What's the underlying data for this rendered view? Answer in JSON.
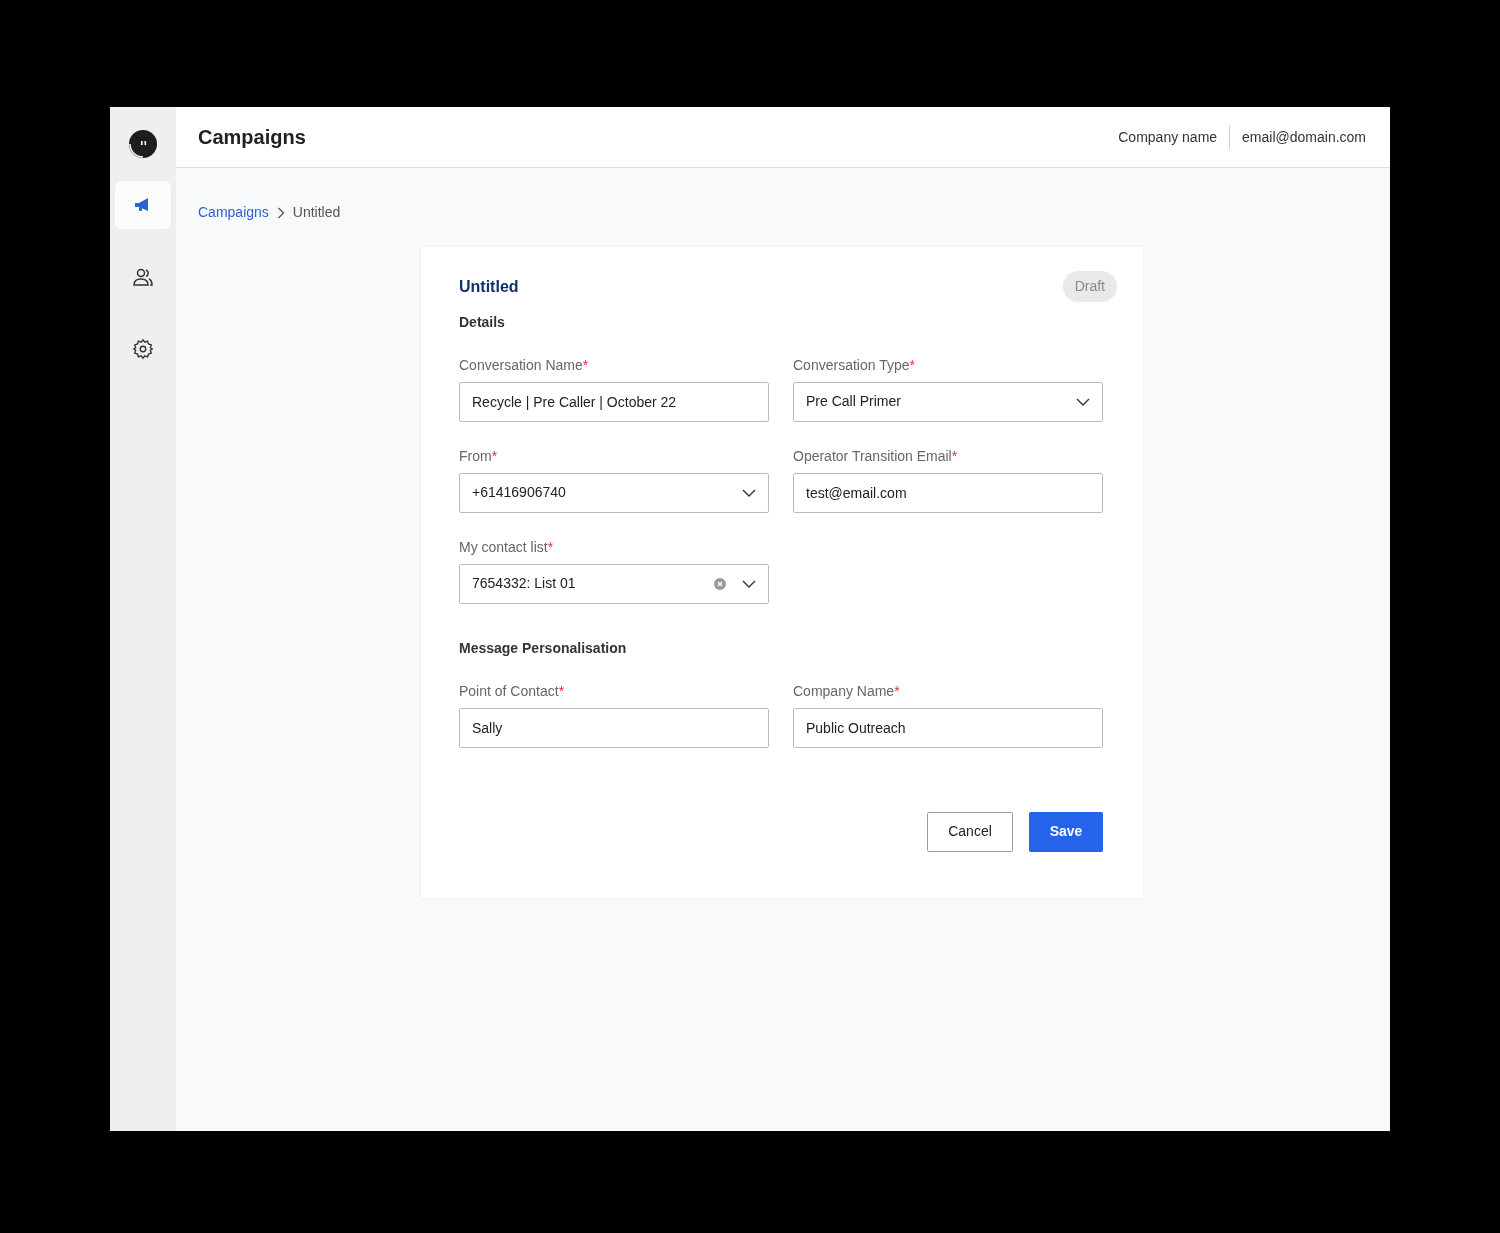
{
  "header": {
    "title": "Campaigns",
    "company": "Company name",
    "email": "email@domain.com"
  },
  "sidebar": {
    "items": [
      {
        "selected": true
      },
      {
        "selected": false
      },
      {
        "selected": false
      }
    ]
  },
  "breadcrumb": [
    {
      "label": "Campaigns",
      "kind": "link"
    },
    {
      "label": "Untitled",
      "kind": "current"
    }
  ],
  "card": {
    "title": "Untitled",
    "status": "Draft",
    "sections": [
      {
        "heading": "Details",
        "fields": [
          {
            "label": "Conversation Name",
            "marker": "*",
            "kind": "text",
            "value": "Recycle | Pre Caller | October 22"
          },
          {
            "label": "Conversation Type",
            "marker": "*",
            "kind": "select",
            "value": "Pre Call Primer",
            "clearable": false
          },
          {
            "label": "From",
            "marker": "*",
            "kind": "select",
            "value": "+61416906740",
            "clearable": false
          },
          {
            "label": "Operator Transition Email",
            "marker": "*",
            "kind": "text",
            "value": "test@email.com"
          },
          {
            "label": "My contact list",
            "marker": "*",
            "kind": "select",
            "value": "7654332: List 01",
            "clearable": true
          }
        ]
      },
      {
        "heading": "Message Personalisation",
        "fields": [
          {
            "label": "Point of Contact",
            "marker": "*",
            "kind": "text",
            "value": "Sally"
          },
          {
            "label": "Company Name",
            "marker": "*",
            "kind": "text",
            "value": "Public Outreach"
          }
        ]
      }
    ],
    "buttons": [
      {
        "label": "Cancel",
        "kind": "secondary"
      },
      {
        "label": "Save",
        "kind": "primary"
      }
    ]
  }
}
